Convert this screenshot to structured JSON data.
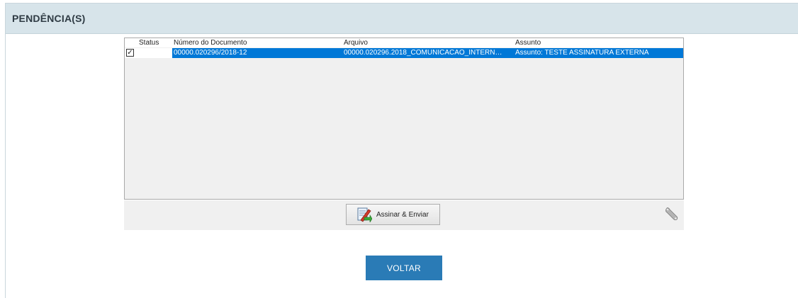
{
  "panel": {
    "title": "PENDÊNCIA(S)"
  },
  "grid": {
    "columns": [
      "Status",
      "Número do Documento",
      "Arquivo",
      "Assunto"
    ],
    "rows": [
      {
        "checked": true,
        "checkmark": "✓",
        "numero": "00000.020296/2018-12",
        "arquivo": "00000.020296.2018_COMUNICACAO_INTERN…",
        "assunto": "Assunto: TESTE ASSINATURA EXTERNA",
        "selected": true
      }
    ]
  },
  "toolbar": {
    "sign_label": "Assinar & Enviar",
    "sign_icon": "sign-document-icon",
    "settings_icon": "wrench-icon"
  },
  "actions": {
    "back_label": "VOLTAR"
  },
  "colors": {
    "header_bg": "#d7e4ea",
    "selection": "#0078d7",
    "primary_button": "#2a7bb6"
  }
}
